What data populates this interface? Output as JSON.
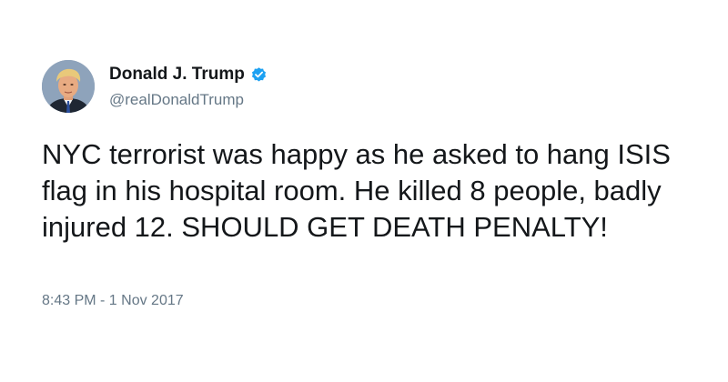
{
  "author": {
    "display_name": "Donald J. Trump",
    "handle": "@realDonaldTrump",
    "verified": true,
    "verified_icon": "verified-badge-icon",
    "verified_color": "#1da1f2"
  },
  "tweet": {
    "text": "NYC terrorist was happy as he asked to hang ISIS flag in his hospital room. He killed 8 people, badly injured 12. SHOULD GET DEATH PENALTY!",
    "timestamp": "8:43 PM - 1 Nov 2017"
  },
  "colors": {
    "text_primary": "#14171a",
    "text_secondary": "#657786",
    "background": "#ffffff"
  }
}
